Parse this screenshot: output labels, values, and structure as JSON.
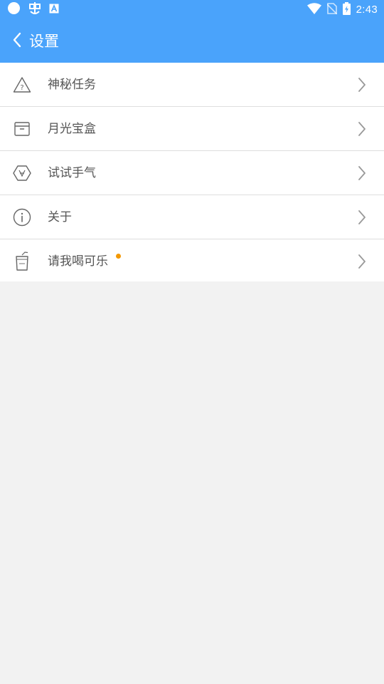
{
  "status_bar": {
    "time": "2:43",
    "left_icons": [
      "circle-icon",
      "bug-icon",
      "a-box-icon"
    ],
    "right_icons": [
      "wifi-icon",
      "no-sim-icon",
      "battery-charging-icon"
    ]
  },
  "app_bar": {
    "title": "设置",
    "back_icon": "chevron-left-icon"
  },
  "settings_items": [
    {
      "label": "神秘任务",
      "icon": "warning-question-icon",
      "badge": false
    },
    {
      "label": "月光宝盒",
      "icon": "box-icon",
      "badge": false
    },
    {
      "label": "试试手气",
      "icon": "hexagon-luck-icon",
      "badge": false
    },
    {
      "label": "关于",
      "icon": "info-icon",
      "badge": false
    },
    {
      "label": "请我喝可乐",
      "icon": "cola-cup-icon",
      "badge": true
    }
  ],
  "colors": {
    "primary": "#4aa3fb",
    "badge_dot": "#f39800",
    "background": "#f2f2f2"
  }
}
